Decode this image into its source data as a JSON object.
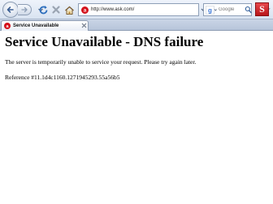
{
  "browser": {
    "url": "http://www.ask.com/",
    "search_placeholder": "Google",
    "search_engine_icon": "google-icon",
    "extension_label": "S"
  },
  "tab": {
    "title": "Service Unavailable"
  },
  "page": {
    "heading": "Service Unavailable - DNS failure",
    "message": "The server is temporarily unable to service your request. Please try again later.",
    "reference": "Reference #11.1d4c1160.1271945293.55a56b5"
  },
  "colors": {
    "ask_brand": "#d4111b",
    "stop_icon": "#c0392b",
    "reload_icon": "#2e6fbd"
  }
}
